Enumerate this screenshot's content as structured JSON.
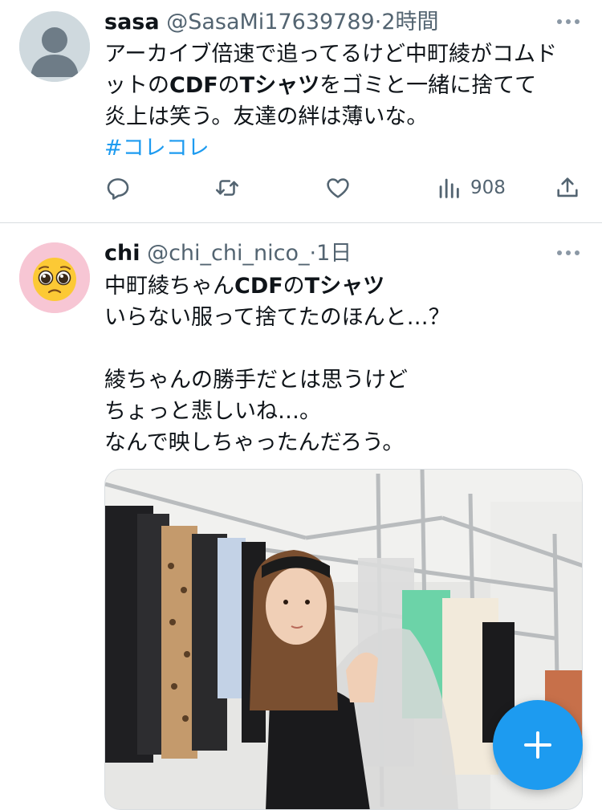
{
  "tweets": [
    {
      "name": "sasa",
      "handle": "@SasaMi17639789",
      "separator": "·",
      "time": "2時間",
      "lines": [
        {
          "a": "アーカイブ倍速で追ってるけど中町綾がコムド"
        },
        {
          "a": "ットの",
          "b1": "CDF",
          "c": "の",
          "b2": "Tシャツ",
          "d": "をゴミと一緒に捨てて"
        },
        {
          "a": "炎上は笑う。友達の絆は薄いな。"
        }
      ],
      "hashtag": "#コレコレ",
      "views": "908",
      "avatar_icon": "default-profile-silhouette-icon"
    },
    {
      "name": "chi",
      "handle": "@chi_chi_nico_",
      "separator": "·",
      "time": "1日",
      "lines": [
        {
          "a": "中町綾ちゃん",
          "b1": "CDF",
          "c": "の",
          "b2": "Tシャツ"
        },
        {
          "a": "いらない服って捨てたのほんと…？"
        },
        {
          "a": ""
        },
        {
          "a": "綾ちゃんの勝手だとは思うけど"
        },
        {
          "a": "ちょっと悲しいね…。"
        },
        {
          "a": "なんで映しちゃったんだろう。"
        }
      ],
      "avatar_icon": "pleading-face-emoji-icon"
    }
  ],
  "colors": {
    "accent": "#1d9bf0",
    "text": "#0f1419",
    "secondary": "#536471",
    "divider": "#d9dde0"
  },
  "icons": {
    "reply": "reply-icon",
    "retweet": "retweet-icon",
    "like": "heart-icon",
    "views": "views-bar-chart-icon",
    "share": "share-upload-icon",
    "more": "more-dots-icon",
    "compose": "plus-icon"
  }
}
